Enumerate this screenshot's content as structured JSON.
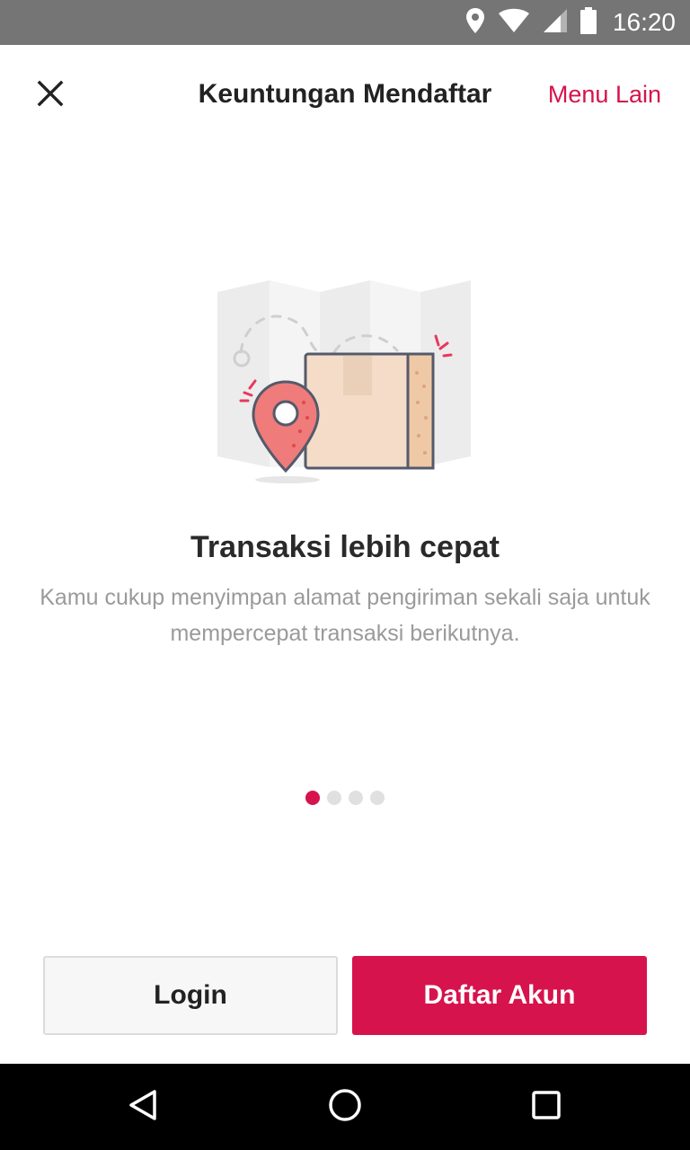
{
  "status_bar": {
    "time": "16:20",
    "icons": [
      "location-icon",
      "wifi-icon",
      "signal-icon",
      "battery-icon"
    ]
  },
  "app_bar": {
    "close_icon": "close-icon",
    "title": "Keuntungan Mendaftar",
    "menu_label": "Menu Lain"
  },
  "slide": {
    "illustration": "map-pin-package-illustration",
    "title": "Transaksi lebih cepat",
    "description": "Kamu cukup menyimpan alamat pengiriman sekali saja untuk mempercepat transaksi berikutnya.",
    "page_count": 4,
    "active_page": 1
  },
  "actions": {
    "login_label": "Login",
    "register_label": "Daftar Akun"
  },
  "colors": {
    "accent": "#d6134c",
    "status_bar": "#757575",
    "nav_bar": "#000000"
  },
  "nav_bar": {
    "icons": [
      "back-icon",
      "home-icon",
      "recent-apps-icon"
    ]
  }
}
